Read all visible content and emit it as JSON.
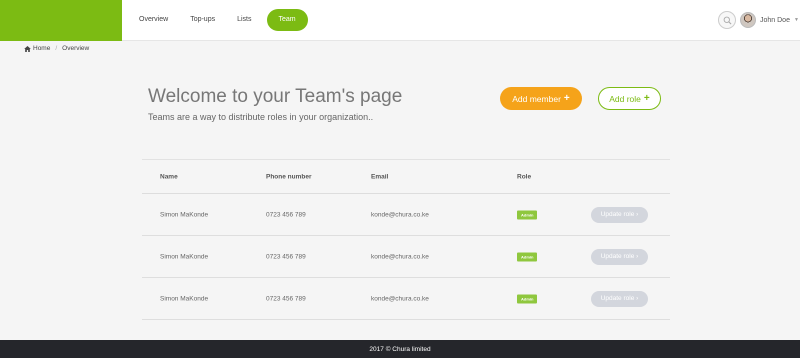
{
  "nav": {
    "items": [
      {
        "label": "Overview"
      },
      {
        "label": "Top-ups"
      },
      {
        "label": "Lists"
      },
      {
        "label": "Team"
      }
    ],
    "active": "Team"
  },
  "user": {
    "name": "John Doe"
  },
  "breadcrumb": {
    "home": "Home",
    "separator": "/",
    "current": "Overview"
  },
  "hero": {
    "title": "Welcome to your Team's page",
    "subtitle": "Teams are a way to distribute roles in your organization..",
    "add_member": "Add member",
    "add_role": "Add role"
  },
  "table": {
    "headers": {
      "name": "Name",
      "phone": "Phone number",
      "email": "Email",
      "role": "Role"
    },
    "rows": [
      {
        "name": "Simon MaKonde",
        "phone": "0723 456 789",
        "email": "konde@chura.co.ke",
        "role": "Admin",
        "action": "Update role ›"
      },
      {
        "name": "Simon MaKonde",
        "phone": "0723 456 789",
        "email": "konde@chura.co.ke",
        "role": "Admin",
        "action": "Update role ›"
      },
      {
        "name": "Simon MaKonde",
        "phone": "0723 456 789",
        "email": "konde@chura.co.ke",
        "role": "Admin",
        "action": "Update role ›"
      }
    ]
  },
  "footer": {
    "text": "2017 © Chura limited"
  },
  "colors": {
    "brand": "#7cbb13",
    "accent": "#f5a31a",
    "footer": "#25262b"
  }
}
